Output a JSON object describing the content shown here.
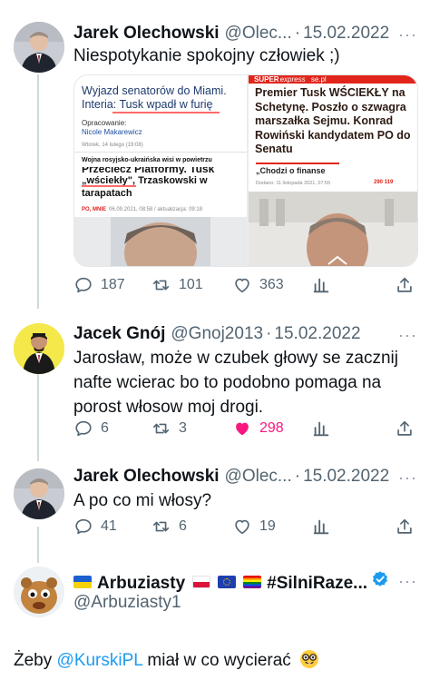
{
  "tweets": [
    {
      "name": "Jarek Olechowski",
      "handle": "@Olec...",
      "date": "15.02.2022",
      "text": "Niespotykanie spokojny człowiek ;)",
      "media": {
        "left": {
          "headline": "Wyjazd senatorów do Miami. Interia: Tusk wpadł w furię",
          "author_label": "Opracowanie:",
          "author": "Nicole Makarewicz",
          "date": "Wtorek, 14 lutego (19:08)",
          "ticker": "Wojna rosyjsko-ukraińska wisi w powietrzu",
          "sub_headline": "„wściekły\", Trzaskowski w tarapatach",
          "source": "PO, MNIE",
          "source_date": "06.09.2021, 08:58 / aktualizacja: 09:18"
        },
        "right": {
          "logo": "SUPER",
          "logo_sub": "express",
          "logo_site": "se.pl",
          "headline": "Premier Tusk WŚCIEKŁY na Schetynę. Poszło o szwagra marszałka Sejmu. Konrad Rowiński kandydatem PO do Senatu",
          "snippet": "„Chodzi o finanse",
          "date": "Dodano: 11 listopada 2021, 07:55",
          "count": "290 119"
        }
      },
      "actions": {
        "replies": "187",
        "retweets": "101",
        "likes": "363"
      }
    },
    {
      "name": "Jacek Gnój",
      "handle": "@Gnoj2013",
      "date": "15.02.2022",
      "text": "Jarosław, może w czubek głowy se zacznij nafte wcierac bo to podobno pomaga na porost włosow moj drogi.",
      "actions": {
        "replies": "6",
        "retweets": "3",
        "likes": "298"
      }
    },
    {
      "name": "Jarek Olechowski",
      "handle": "@Olec...",
      "date": "15.02.2022",
      "text": "A po co mi włosy?",
      "actions": {
        "replies": "41",
        "retweets": "6",
        "likes": "19"
      }
    },
    {
      "name": "Arbuziasty",
      "name_suffix": "#SilniRaze...",
      "handle": "@Arbuziasty1",
      "text_before": "Żeby ",
      "mention": "@KurskiPL",
      "text_after": " miał w co wycierać"
    }
  ],
  "more_glyph": "···",
  "separator_glyph": "·",
  "colors": {
    "text": "#0f1419",
    "secondary": "#536471",
    "link": "#1d9bf0",
    "like": "#f91880",
    "thread": "#cfd9de"
  },
  "icons": [
    "reply-icon",
    "retweet-icon",
    "like-icon",
    "views-icon",
    "share-icon",
    "verified-icon",
    "more-icon"
  ]
}
